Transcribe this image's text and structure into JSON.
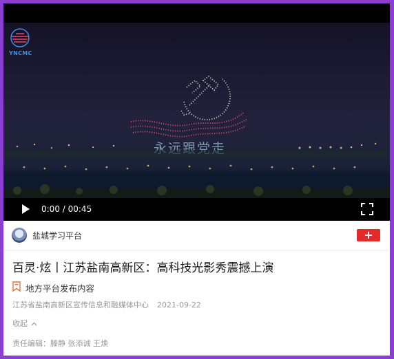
{
  "video": {
    "logo_text": "YNCMC",
    "overlay_text": "永远跟党走",
    "time_display": "0:00 / 00:45"
  },
  "author": {
    "name": "盐城学习平台",
    "follow_label": "+"
  },
  "article": {
    "title": "百灵·炫丨江苏盐南高新区：高科技光影秀震撼上演",
    "source_label": "地方平台发布内容",
    "publisher": "江苏省盐南高新区宣传信息和融媒体中心",
    "date": "2021-09-22",
    "collapse_label": "收起",
    "editors": "责任编辑：滕静 张添诚 王焕"
  },
  "colors": {
    "frame_border": "#8b3fd0",
    "follow_button": "#e52a2a",
    "muted_text": "#999999"
  },
  "icons": [
    "play-icon",
    "fullscreen-icon",
    "source-badge-icon",
    "chevron-up-icon"
  ]
}
